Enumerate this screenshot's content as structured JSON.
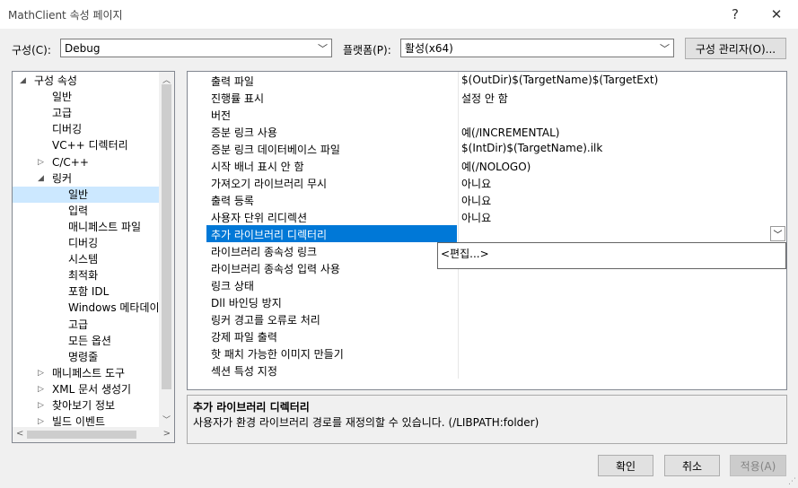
{
  "window": {
    "title": "MathClient 속성 페이지",
    "help": "?",
    "close": "✕"
  },
  "toolbar": {
    "config_label": "구성(C):",
    "config_value": "Debug",
    "platform_label": "플랫폼(P):",
    "platform_value": "활성(x64)",
    "manager_label": "구성 관리자(O)..."
  },
  "tree": {
    "items": [
      {
        "label": "구성 속성",
        "twisty": "◢"
      },
      {
        "label": "일반",
        "twisty": ""
      },
      {
        "label": "고급",
        "twisty": ""
      },
      {
        "label": "디버깅",
        "twisty": ""
      },
      {
        "label": "VC++ 디렉터리",
        "twisty": ""
      },
      {
        "label": "C/C++",
        "twisty": "▷"
      },
      {
        "label": "링커",
        "twisty": "◢"
      },
      {
        "label": "일반",
        "twisty": ""
      },
      {
        "label": "입력",
        "twisty": ""
      },
      {
        "label": "매니페스트 파일",
        "twisty": ""
      },
      {
        "label": "디버깅",
        "twisty": ""
      },
      {
        "label": "시스템",
        "twisty": ""
      },
      {
        "label": "최적화",
        "twisty": ""
      },
      {
        "label": "포함 IDL",
        "twisty": ""
      },
      {
        "label": "Windows 메타데이",
        "twisty": ""
      },
      {
        "label": "고급",
        "twisty": ""
      },
      {
        "label": "모든 옵션",
        "twisty": ""
      },
      {
        "label": "명령줄",
        "twisty": ""
      },
      {
        "label": "매니페스트 도구",
        "twisty": "▷"
      },
      {
        "label": "XML 문서 생성기",
        "twisty": "▷"
      },
      {
        "label": "찾아보기 정보",
        "twisty": "▷"
      },
      {
        "label": "빌드 이벤트",
        "twisty": "▷"
      }
    ]
  },
  "grid": {
    "rows": [
      {
        "name": "출력 파일",
        "value": "$(OutDir)$(TargetName)$(TargetExt)"
      },
      {
        "name": "진행률 표시",
        "value": "설정 안 함"
      },
      {
        "name": "버전",
        "value": ""
      },
      {
        "name": "증분 링크 사용",
        "value": "예(/INCREMENTAL)"
      },
      {
        "name": "증분 링크 데이터베이스 파일",
        "value": "$(IntDir)$(TargetName).ilk"
      },
      {
        "name": "시작 배너 표시 안 함",
        "value": "예(/NOLOGO)"
      },
      {
        "name": "가져오기 라이브러리 무시",
        "value": "아니요"
      },
      {
        "name": "출력 등록",
        "value": "아니요"
      },
      {
        "name": "사용자 단위 리디렉션",
        "value": "아니요"
      },
      {
        "name": "추가 라이브러리 디렉터리",
        "value": ""
      },
      {
        "name": "라이브러리 종속성 링크",
        "value": ""
      },
      {
        "name": "라이브러리 종속성 입력 사용",
        "value": ""
      },
      {
        "name": "링크 상태",
        "value": ""
      },
      {
        "name": "Dll 바인딩 방지",
        "value": ""
      },
      {
        "name": "링커 경고를 오류로 처리",
        "value": ""
      },
      {
        "name": "강제 파일 출력",
        "value": ""
      },
      {
        "name": "핫 패치 가능한 이미지 만들기",
        "value": ""
      },
      {
        "name": "섹션 특성 지정",
        "value": ""
      }
    ],
    "popup_option": "<편집...>"
  },
  "description": {
    "title": "추가 라이브러리 디렉터리",
    "text": "사용자가 환경 라이브러리 경로를 재정의할 수 있습니다. (/LIBPATH:folder)"
  },
  "buttons": {
    "ok": "확인",
    "cancel": "취소",
    "apply": "적용(A)"
  }
}
